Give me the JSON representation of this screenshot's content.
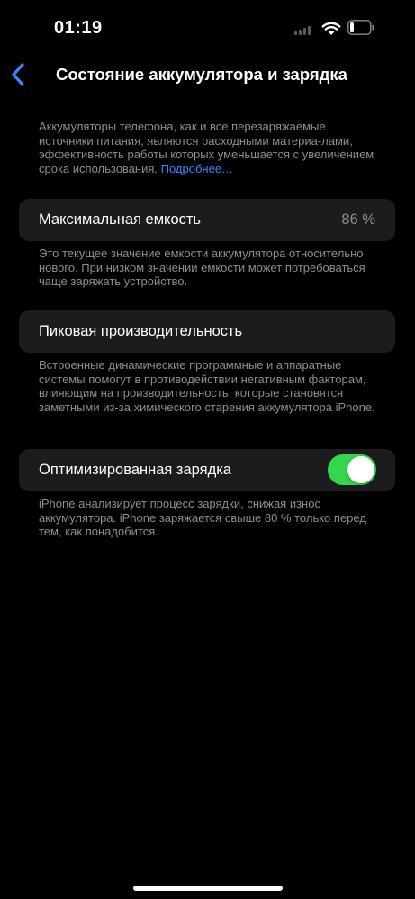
{
  "status_bar": {
    "time": "01:19",
    "icons": [
      "cellular-signal-icon",
      "wifi-icon",
      "battery-low-icon"
    ]
  },
  "nav": {
    "back_icon": "chevron-left-icon",
    "title": "Состояние аккумулятора и зарядка"
  },
  "intro": {
    "text": "Аккумуляторы телефона, как и все перезаряжаемые источники питания, являются расходными материа-лами, эффективность работы которых уменьшается с увеличением срока использования. ",
    "link": "Подробнее…"
  },
  "max_capacity": {
    "label": "Максимальная емкость",
    "value": "86 %",
    "description": "Это текущее значение емкости аккумулятора относительно нового. При низком значении емкости может потребоваться чаще заряжать устройство."
  },
  "peak_performance": {
    "label": "Пиковая производительность",
    "description": "Встроенные динамические программные и аппаратные системы помогут в противодействии негативным факторам, влияющим на производительность, которые становятся заметными из-за химического старения аккумулятора iPhone."
  },
  "optimized_charging": {
    "label": "Оптимизированная зарядка",
    "enabled": true,
    "description": "iPhone анализирует процесс зарядки, снижая износ аккумулятора. iPhone заряжается свыше 80 % только перед тем, как понадобится."
  },
  "colors": {
    "background": "#000000",
    "cell": "#1c1c1e",
    "accent": "#3a86ff",
    "toggle_on": "#32d74b",
    "secondary_text": "#8d8d93"
  }
}
